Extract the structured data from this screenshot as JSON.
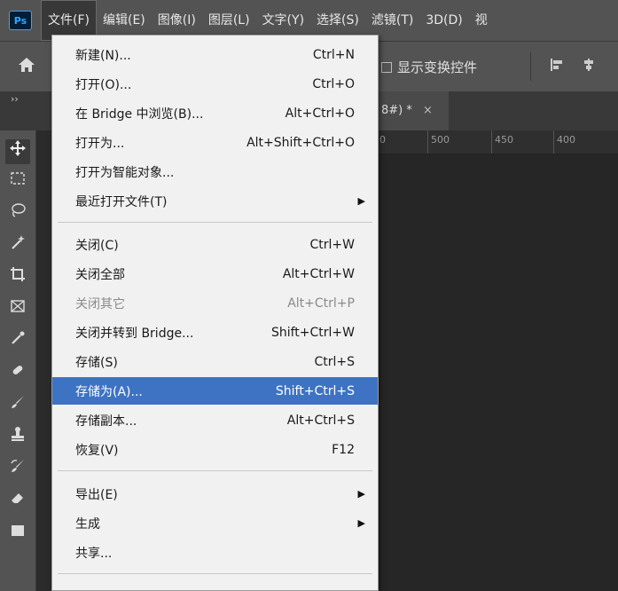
{
  "app": {
    "logo": "Ps"
  },
  "menubar": {
    "items": [
      "文件(F)",
      "编辑(E)",
      "图像(I)",
      "图层(L)",
      "文字(Y)",
      "选择(S)",
      "滤镜(T)",
      "3D(D)",
      "视"
    ]
  },
  "options": {
    "show_transform_controls": "显示变换控件"
  },
  "tabs": {
    "panel_toggle": "››",
    "document_tab": "8#) *",
    "close": "×"
  },
  "ruler": {
    "ticks": [
      "0",
      "500",
      "450",
      "400"
    ]
  },
  "file_menu": {
    "items": [
      {
        "label": "新建(N)...",
        "shortcut": "Ctrl+N"
      },
      {
        "label": "打开(O)...",
        "shortcut": "Ctrl+O"
      },
      {
        "label": "在 Bridge 中浏览(B)...",
        "shortcut": "Alt+Ctrl+O"
      },
      {
        "label": "打开为...",
        "shortcut": "Alt+Shift+Ctrl+O"
      },
      {
        "label": "打开为智能对象...",
        "shortcut": ""
      },
      {
        "label": "最近打开文件(T)",
        "shortcut": ""
      },
      {
        "label": "关闭(C)",
        "shortcut": "Ctrl+W"
      },
      {
        "label": "关闭全部",
        "shortcut": "Alt+Ctrl+W"
      },
      {
        "label": "关闭其它",
        "shortcut": "Alt+Ctrl+P"
      },
      {
        "label": "关闭并转到 Bridge...",
        "shortcut": "Shift+Ctrl+W"
      },
      {
        "label": "存储(S)",
        "shortcut": "Ctrl+S"
      },
      {
        "label": "存储为(A)...",
        "shortcut": "Shift+Ctrl+S"
      },
      {
        "label": "存储副本...",
        "shortcut": "Alt+Ctrl+S"
      },
      {
        "label": "恢复(V)",
        "shortcut": "F12"
      },
      {
        "label": "导出(E)",
        "shortcut": ""
      },
      {
        "label": "生成",
        "shortcut": ""
      },
      {
        "label": "共享...",
        "shortcut": ""
      }
    ]
  },
  "colors": {
    "highlight": "#3e73c3",
    "menu_bg": "#f1f1f1",
    "app_bg": "#535353"
  }
}
